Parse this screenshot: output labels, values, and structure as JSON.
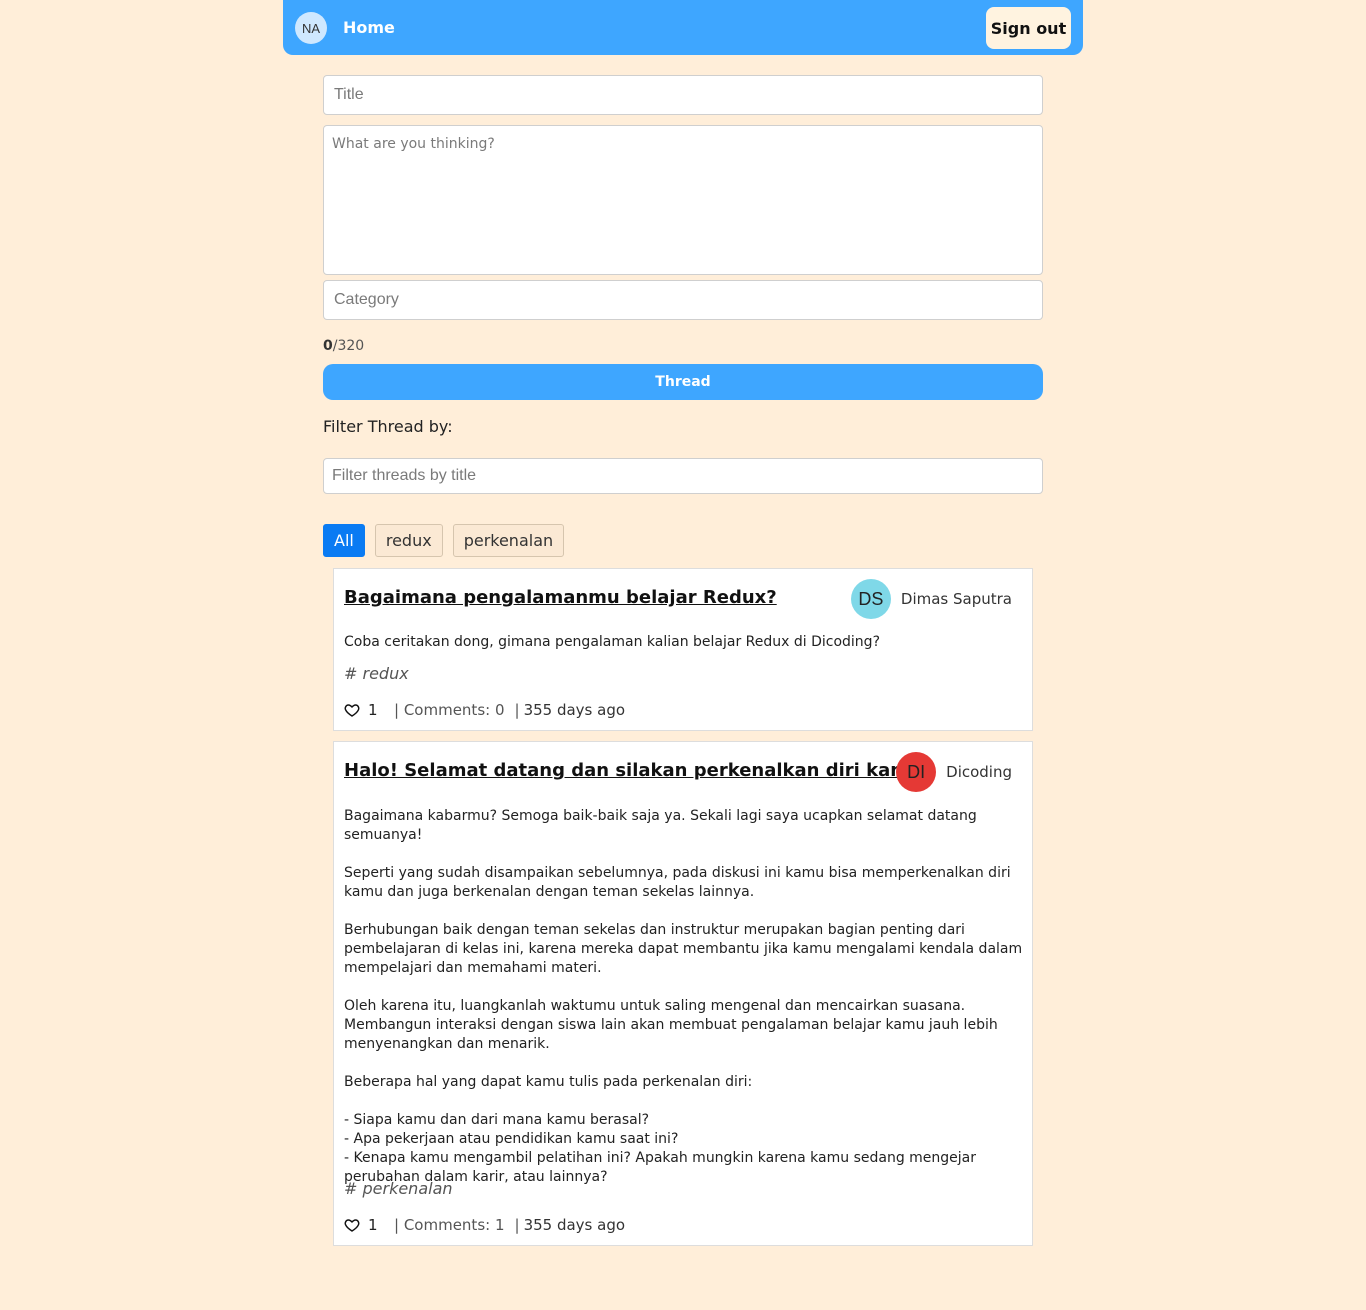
{
  "nav": {
    "avatar_initials": "NA",
    "home_label": "Home",
    "signout_label": "Sign out",
    "color": "#3ea6ff"
  },
  "form": {
    "title_placeholder": "Title",
    "title_value": "",
    "body_placeholder": "What are you thinking?",
    "body_value": "",
    "category_placeholder": "Category",
    "category_value": "",
    "char_count": "0",
    "char_max": "/320",
    "submit_label": "Thread"
  },
  "filter": {
    "label": "Filter Thread by:",
    "placeholder": "Filter threads by title",
    "value": ""
  },
  "categories": {
    "all": "All",
    "items": [
      "redux",
      "perkenalan"
    ],
    "active": "All"
  },
  "threads": [
    {
      "title": "Bagaimana pengalamanmu belajar Redux?",
      "owner_initials": "DS",
      "owner_name": "Dimas Saputra",
      "owner_color": "#7fd8e8",
      "body": "Coba ceritakan dong, gimana pengalaman kalian belajar Redux di Dicoding?",
      "category": "# redux",
      "likes": "1",
      "comments": "| Comments: 0",
      "sep": "|",
      "age": "355 days ago"
    },
    {
      "title": "Halo! Selamat datang dan silakan perkenalkan diri kamu",
      "owner_initials": "DI",
      "owner_name": "Dicoding",
      "owner_color": "#e53935",
      "body": "Bagaimana kabarmu? Semoga baik-baik saja ya. Sekali lagi saya ucapkan selamat datang semuanya!\n\nSeperti yang sudah disampaikan sebelumnya, pada diskusi ini kamu bisa memperkenalkan diri kamu dan juga berkenalan dengan teman sekelas lainnya.\n\nBerhubungan baik dengan teman sekelas dan instruktur merupakan bagian penting dari pembelajaran di kelas ini, karena mereka dapat membantu jika kamu mengalami kendala dalam mempelajari dan memahami materi.\n\nOleh karena itu, luangkanlah waktumu untuk saling mengenal dan mencairkan suasana. Membangun interaksi dengan siswa lain akan membuat pengalaman belajar kamu jauh lebih menyenangkan dan menarik.\n\nBeberapa hal yang dapat kamu tulis pada perkenalan diri:\n\n- Siapa kamu dan dari mana kamu berasal?\n- Apa pekerjaan atau pendidikan kamu saat ini?\n- Kenapa kamu mengambil pelatihan ini? Apakah mungkin karena kamu sedang mengejar perubahan dalam karir, atau lainnya?",
      "category": "# perkenalan",
      "likes": "1",
      "comments": "| Comments: 1",
      "sep": "|",
      "age": "355 days ago"
    }
  ]
}
